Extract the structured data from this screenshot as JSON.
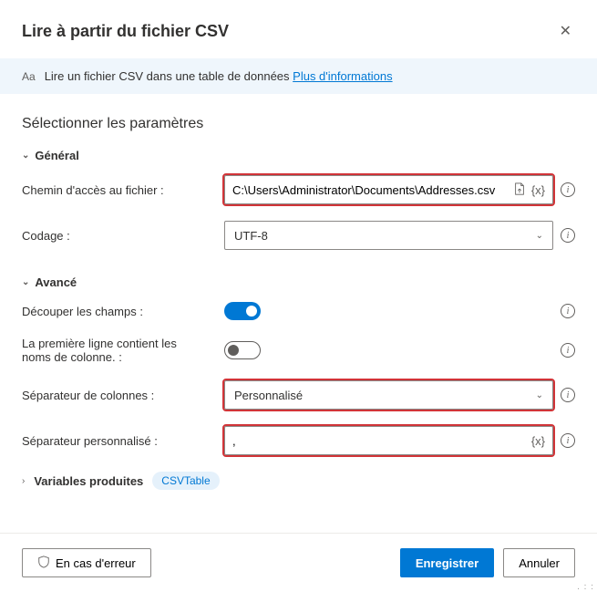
{
  "header": {
    "title": "Lire à partir du fichier CSV"
  },
  "banner": {
    "icon_label": "Aa",
    "text": "Lire un fichier CSV dans une table de données ",
    "link": "Plus d'informations"
  },
  "section_title": "Sélectionner les paramètres",
  "groups": {
    "general": "Général",
    "advanced": "Avancé"
  },
  "fields": {
    "file_path": {
      "label": "Chemin d'accès au fichier :",
      "value": "C:\\Users\\Administrator\\Documents\\Addresses.csv"
    },
    "encoding": {
      "label": "Codage :",
      "value": "UTF-8"
    },
    "trim_fields": {
      "label": "Découper les champs :",
      "value": true
    },
    "first_line_headers": {
      "label": "La première ligne contient les noms de colonne. :",
      "value": false
    },
    "column_separator": {
      "label": "Séparateur de colonnes :",
      "value": "Personnalisé"
    },
    "custom_separator": {
      "label": "Séparateur personnalisé :",
      "value": ","
    }
  },
  "variables": {
    "label": "Variables produites",
    "pill": "CSVTable"
  },
  "footer": {
    "on_error": "En cas d'erreur",
    "save": "Enregistrer",
    "cancel": "Annuler"
  },
  "icons": {
    "var_token": "{x}"
  }
}
